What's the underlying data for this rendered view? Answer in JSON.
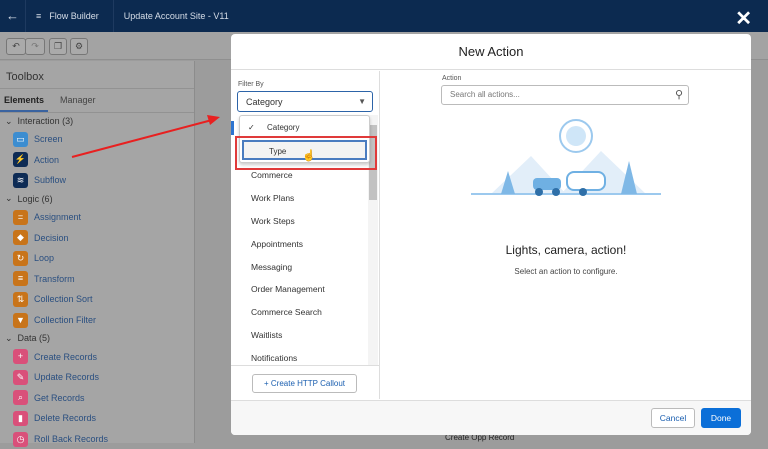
{
  "topbar": {
    "app_name": "Flow Builder",
    "flow_title": "Update Account Site - V11"
  },
  "sidebar": {
    "title": "Toolbox",
    "tabs": [
      "Elements",
      "Manager"
    ],
    "sections": [
      {
        "label": "Interaction (3)",
        "items": [
          {
            "label": "Screen",
            "color": "#3c8dd0"
          },
          {
            "label": "Action",
            "color": "#0d2b55"
          },
          {
            "label": "Subflow",
            "color": "#0d2b55"
          }
        ]
      },
      {
        "label": "Logic (6)",
        "items": [
          {
            "label": "Assignment",
            "color": "#c8741a"
          },
          {
            "label": "Decision",
            "color": "#c8741a"
          },
          {
            "label": "Loop",
            "color": "#c8741a"
          },
          {
            "label": "Transform",
            "color": "#c8741a"
          },
          {
            "label": "Collection Sort",
            "color": "#c8741a"
          },
          {
            "label": "Collection Filter",
            "color": "#c8741a"
          }
        ]
      },
      {
        "label": "Data (5)",
        "items": [
          {
            "label": "Create Records",
            "color": "#d9507a"
          },
          {
            "label": "Update Records",
            "color": "#d9507a"
          },
          {
            "label": "Get Records",
            "color": "#d9507a"
          },
          {
            "label": "Delete Records",
            "color": "#d9507a"
          },
          {
            "label": "Roll Back Records",
            "color": "#d9507a"
          }
        ]
      }
    ]
  },
  "canvas": {
    "node_label": "Create Opp Record"
  },
  "modal": {
    "title": "New Action",
    "filter_label": "Filter By",
    "filter_value": "Category",
    "filter_options": [
      "Category",
      "Type"
    ],
    "categories": [
      "Commerce",
      "Work Plans",
      "Work Steps",
      "Appointments",
      "Messaging",
      "Order Management",
      "Commerce Search",
      "Waitlists",
      "Notifications"
    ],
    "http_button": "Create HTTP Callout",
    "action_label": "Action",
    "search_placeholder": "Search all actions...",
    "empty_title": "Lights, camera, action!",
    "empty_sub": "Select an action to configure.",
    "cancel": "Cancel",
    "done": "Done"
  }
}
